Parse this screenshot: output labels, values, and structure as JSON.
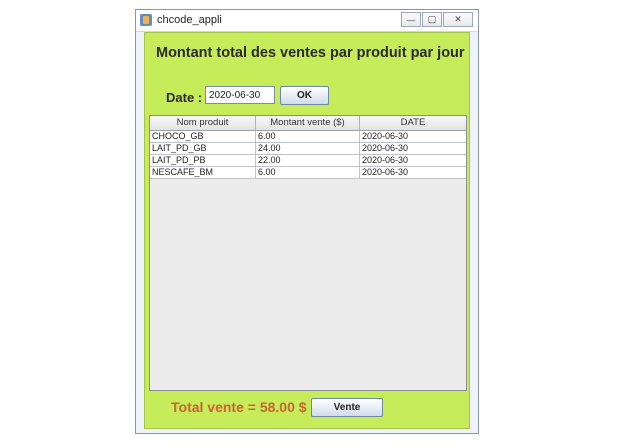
{
  "window": {
    "title": "chcode_appli",
    "minimize_glyph": "—",
    "maximize_glyph": "▢",
    "close_glyph": "✕"
  },
  "heading": "Montant total des ventes par produit par jour",
  "date": {
    "label": "Date :",
    "value": "2020-06-30",
    "ok_label": "OK"
  },
  "table": {
    "columns": [
      "Nom produit",
      "Montant vente ($)",
      "DATE"
    ],
    "rows": [
      [
        "CHOCO_GB",
        "6.00",
        "2020-06-30"
      ],
      [
        "LAIT_PD_GB",
        "24.00",
        "2020-06-30"
      ],
      [
        "LAIT_PD_PB",
        "22.00",
        "2020-06-30"
      ],
      [
        "NESCAFE_BM",
        "6.00",
        "2020-06-30"
      ]
    ]
  },
  "footer": {
    "total_text": "Total vente = 58.00 $",
    "vente_label": "Vente"
  },
  "colors": {
    "panel_bg": "#c6ec5a",
    "total_text": "#c8642e"
  }
}
